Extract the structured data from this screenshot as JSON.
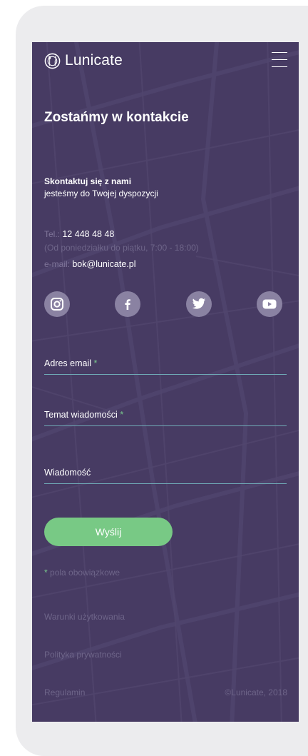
{
  "brand": {
    "name": "Lunicate",
    "logo_icon": "fork-knife-circle-icon"
  },
  "header": {
    "menu_icon": "hamburger-menu-icon"
  },
  "page": {
    "title": "Zostańmy w kontakcie"
  },
  "contact": {
    "heading": "Skontaktuj się z nami",
    "subheading": "jesteśmy do Twojej dyspozycji",
    "tel_label": "Tel.:",
    "tel_value": "12 448 48 48",
    "hours": "(Od poniedziałku do piątku, 7:00 - 18:00)",
    "email_label": "e-mail:",
    "email_value": "bok@lunicate.pl"
  },
  "social": [
    {
      "name": "instagram",
      "icon": "instagram-icon"
    },
    {
      "name": "facebook",
      "icon": "facebook-icon"
    },
    {
      "name": "twitter",
      "icon": "twitter-icon"
    },
    {
      "name": "youtube",
      "icon": "youtube-icon"
    }
  ],
  "form": {
    "email_label": "Adres email",
    "subject_label": "Temat wiadomości",
    "message_label": "Wiadomość",
    "required_marker": "*",
    "submit_label": "Wyślij",
    "required_note": "pola obowiązkowe"
  },
  "footer": {
    "terms": "Warunki użytkowania",
    "privacy": "Polityka prywatności",
    "rules": "Regulamin",
    "copyright": "©Lunicate, 2018"
  },
  "colors": {
    "background": "#473b63",
    "accent_green": "#78c985",
    "field_underline": "#6fa9b6",
    "muted_text": "#6e6589",
    "social_circle": "#8a82a2"
  }
}
